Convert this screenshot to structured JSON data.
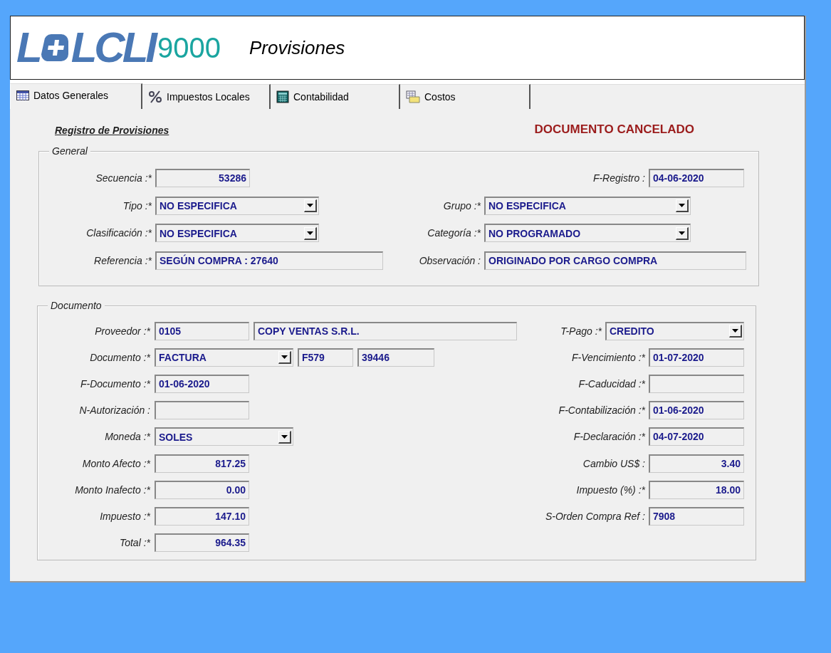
{
  "header": {
    "logo": {
      "first": "L",
      "rest": "LCLI",
      "number": "9000"
    },
    "title": "Provisiones"
  },
  "tabs": [
    {
      "label": "Datos Generales",
      "selected": true
    },
    {
      "label": "Impuestos Locales",
      "selected": false
    },
    {
      "label": "Contabilidad",
      "selected": false
    },
    {
      "label": "Costos",
      "selected": false
    }
  ],
  "form": {
    "heading": "Registro de Provisiones",
    "status": "DOCUMENTO CANCELADO"
  },
  "general": {
    "legend": "General",
    "left": [
      {
        "label": "Secuencia :*",
        "fields": [
          {
            "kind": "number",
            "value": "53286"
          }
        ]
      },
      {
        "label": "Tipo :*",
        "fields": [
          {
            "kind": "select",
            "value": "NO ESPECIFICA"
          }
        ]
      },
      {
        "label": "Clasificación :*",
        "fields": [
          {
            "kind": "select",
            "value": "NO ESPECIFICA"
          }
        ]
      },
      {
        "label": "Referencia :*",
        "fields": [
          {
            "kind": "text",
            "value": "SEGÚN COMPRA : 27640"
          }
        ]
      }
    ],
    "right": [
      {
        "label": "F-Registro :",
        "fields": [
          {
            "kind": "text",
            "value": "04-06-2020"
          }
        ]
      },
      {
        "label": "Grupo :*",
        "fields": [
          {
            "kind": "select",
            "value": "NO ESPECIFICA"
          }
        ]
      },
      {
        "label": "Categoría :*",
        "fields": [
          {
            "kind": "select",
            "value": "NO PROGRAMADO"
          }
        ]
      },
      {
        "label": "Observación :",
        "fields": [
          {
            "kind": "text",
            "value": "ORIGINADO POR CARGO COMPRA"
          }
        ]
      }
    ]
  },
  "documento": {
    "legend": "Documento",
    "left": [
      {
        "label": "Proveedor :*",
        "fields": [
          {
            "kind": "text",
            "value": "0105"
          },
          {
            "kind": "text",
            "value": "COPY VENTAS S.R.L."
          }
        ]
      },
      {
        "label": "Documento :*",
        "fields": [
          {
            "kind": "select",
            "value": "FACTURA"
          },
          {
            "kind": "text",
            "value": "F579"
          },
          {
            "kind": "text",
            "value": "39446"
          }
        ]
      },
      {
        "label": "F-Documento :*",
        "fields": [
          {
            "kind": "text",
            "value": "01-06-2020"
          }
        ]
      },
      {
        "label": "N-Autorización :",
        "fields": [
          {
            "kind": "empty"
          }
        ]
      },
      {
        "label": "Moneda :*",
        "fields": [
          {
            "kind": "select",
            "value": "SOLES"
          }
        ]
      },
      {
        "label": "Monto Afecto :*",
        "fields": [
          {
            "kind": "number",
            "value": "817.25"
          }
        ]
      },
      {
        "label": "Monto Inafecto :*",
        "fields": [
          {
            "kind": "number",
            "value": "0.00"
          }
        ]
      },
      {
        "label": "Impuesto :*",
        "fields": [
          {
            "kind": "number",
            "value": "147.10"
          }
        ]
      },
      {
        "label": "Total :*",
        "fields": [
          {
            "kind": "number",
            "value": "964.35"
          }
        ]
      }
    ],
    "right": [
      {
        "label": "T-Pago :*",
        "fields": [
          {
            "kind": "select",
            "value": "CREDITO"
          }
        ]
      },
      {
        "label": "F-Vencimiento :*",
        "fields": [
          {
            "kind": "text",
            "value": "01-07-2020"
          }
        ]
      },
      {
        "label": "F-Caducidad :*",
        "fields": [
          {
            "kind": "empty"
          }
        ]
      },
      {
        "label": "F-Contabilización :*",
        "fields": [
          {
            "kind": "text",
            "value": "01-06-2020"
          }
        ]
      },
      {
        "label": "F-Declaración :*",
        "fields": [
          {
            "kind": "text",
            "value": "04-07-2020"
          }
        ]
      },
      {
        "label": "Cambio US$ :",
        "fields": [
          {
            "kind": "number",
            "value": "3.40"
          }
        ]
      },
      {
        "label": "Impuesto (%) :*",
        "fields": [
          {
            "kind": "number",
            "value": "18.00"
          }
        ]
      },
      {
        "label": "S-Orden Compra Ref :",
        "fields": [
          {
            "kind": "text",
            "value": "7908"
          }
        ]
      }
    ]
  }
}
